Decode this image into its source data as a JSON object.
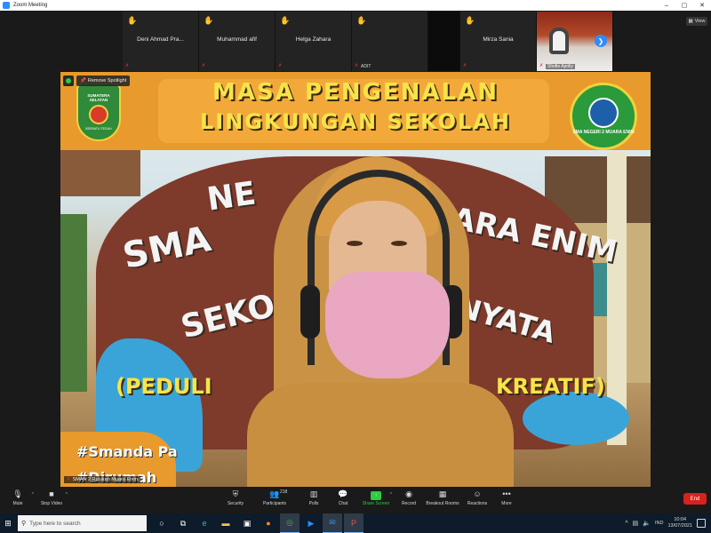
{
  "window": {
    "title": "Zoom Meeting",
    "controls": [
      "–",
      "▢",
      "✕"
    ]
  },
  "view_button": {
    "label": "View"
  },
  "gallery": {
    "tiles": [
      {
        "name": "Deni Ahmad Pra...",
        "hand_raised": true,
        "muted": true
      },
      {
        "name": "Muhammad afif",
        "hand_raised": true,
        "muted": true
      },
      {
        "name": "Helga Zahara",
        "hand_raised": true,
        "muted": true
      },
      {
        "name": "",
        "caption": "ADIT",
        "hand_raised": true,
        "muted": true
      },
      {
        "name": "Mirza Sania",
        "hand_raised": true,
        "muted": true
      },
      {
        "name": "",
        "caption": "Shofie Apriliy",
        "video": true,
        "muted": true
      }
    ]
  },
  "spotlight": {
    "remove_label": "Remove Spotlight",
    "participant_label": "SMAN 2 Rujukan Muara Enim",
    "headline_line1": "MASA PENGENALAN",
    "headline_line2": "LINGKUNGAN SEKOLAH",
    "wall_sma": "SMA",
    "wall_ne": "NE",
    "wall_juara": "JUARA ENIM",
    "wall_sek": "SEKO",
    "wall_yata": "NYATA",
    "slogan_left": "(PEDULI",
    "slogan_right": "KREATIF)",
    "hashtag_1": "#Smanda Pa",
    "hashtag_2": "#Dirumah",
    "crest_left_top": "SUMATERA SELATAN",
    "crest_left_motto": "BERSATU TEGUH",
    "crest_right_text": "SMA NEGERI 2 MUARA ENIM"
  },
  "toolbar": {
    "items": [
      {
        "label": "Mute",
        "icon": "microphone-icon"
      },
      {
        "label": "Stop Video",
        "icon": "video-camera-icon"
      },
      {
        "label": "Security",
        "icon": "shield-icon"
      },
      {
        "label": "Participants",
        "icon": "participants-icon",
        "count": "218"
      },
      {
        "label": "Polls",
        "icon": "polls-icon"
      },
      {
        "label": "Chat",
        "icon": "chat-icon"
      },
      {
        "label": "Share Screen",
        "icon": "share-screen-icon"
      },
      {
        "label": "Record",
        "icon": "record-icon"
      },
      {
        "label": "Breakout Rooms",
        "icon": "breakout-rooms-icon"
      },
      {
        "label": "Reactions",
        "icon": "reactions-icon"
      },
      {
        "label": "More",
        "icon": "more-icon"
      }
    ],
    "end_label": "End"
  },
  "taskbar": {
    "search_placeholder": "Type here to search",
    "apps": [
      "cortana-icon",
      "task-view-icon",
      "edge-icon",
      "file-explorer-icon",
      "store-icon",
      "firefox-icon",
      "chrome-icon",
      "zoom-icon",
      "mail-icon",
      "powerpoint-icon"
    ],
    "language": "IND",
    "time": "10:04",
    "date": "13/07/2021"
  },
  "colors": {
    "zoom_blue": "#2d8cff",
    "end_red": "#d7221d",
    "share_green": "#2ecc40",
    "hand_yellow": "#f5b400"
  }
}
